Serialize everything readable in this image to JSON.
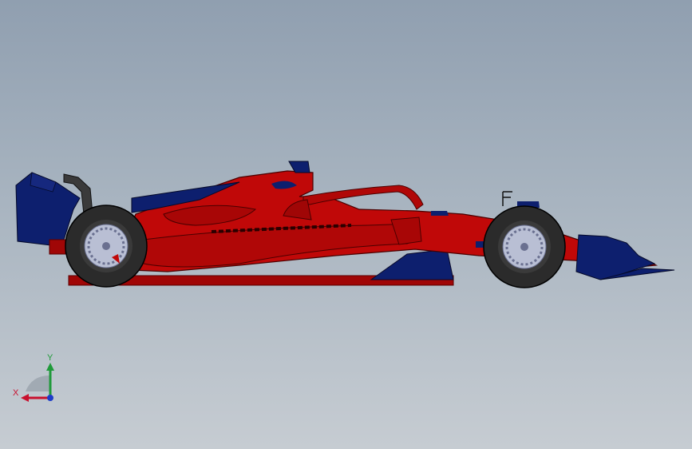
{
  "viewport": {
    "background_top": "#909fb0",
    "background_bottom": "#c6ccd2"
  },
  "model": {
    "subject": "formula-1-car-side-view",
    "body_color": "#c00808",
    "accent_color": "#0d1f6e",
    "tire_color": "#2b2b2b",
    "rim_color": "#b9bfd4"
  },
  "triad": {
    "x_label": "X",
    "y_label": "Y",
    "x_color": "#c8102e",
    "y_color": "#1f9a3a",
    "z_color": "#1e3cc8"
  }
}
